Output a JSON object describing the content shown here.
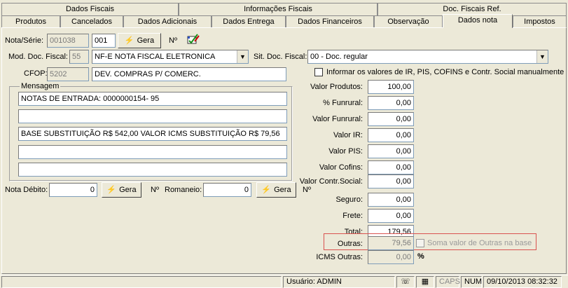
{
  "tabs_top": [
    "Dados Fiscais",
    "Informações Fiscais",
    "Doc. Fiscais Ref."
  ],
  "tabs_bottom": [
    "Produtos",
    "Cancelados",
    "Dados Adicionais",
    "Dados Entrega",
    "Dados Financeiros",
    "Observação",
    "Dados nota",
    "Impostos"
  ],
  "nota": {
    "nota_serie_label": "Nota/Série:",
    "numero": "001038",
    "serie": "001",
    "gera_label": "Gera",
    "n_label": "Nº"
  },
  "mod_doc": {
    "label": "Mod. Doc. Fiscal:",
    "code": "55",
    "desc": "NF-E NOTA FISCAL ELETRONICA"
  },
  "sit_doc": {
    "label": "Sit. Doc. Fiscal:",
    "value": "00 - Doc. regular"
  },
  "cfop": {
    "label": "CFOP:",
    "code": "5202",
    "desc": "DEV. COMPRAS P/ COMERC."
  },
  "manual_check_label": "Informar os valores de IR, PIS, COFINS e Contr. Social manualmente",
  "mensagem": {
    "title": "Mensagem",
    "lines": [
      "NOTAS DE ENTRADA: 0000000154- 95",
      "",
      "BASE SUBSTITUIÇÃO R$ 542,00 VALOR ICMS SUBSTITUIÇÃO R$ 79,56",
      "",
      ""
    ]
  },
  "nota_debito": {
    "label": "Nota Débito:",
    "value": "0",
    "gera_label": "Gera",
    "n_label": "Nº"
  },
  "romaneio": {
    "label": "Romaneio:",
    "value": "0",
    "gera_label": "Gera"
  },
  "valores": [
    {
      "label": "Valor Produtos:",
      "value": "100,00"
    },
    {
      "label": "% Funrural:",
      "value": "0,00"
    },
    {
      "label": "Valor Funrural:",
      "value": "0,00"
    },
    {
      "label": "Valor IR:",
      "value": "0,00"
    },
    {
      "label": "Valor PIS:",
      "value": "0,00"
    },
    {
      "label": "Valor Cofins:",
      "value": "0,00"
    },
    {
      "label": "Valor Contr.Social:",
      "value": "0,00"
    },
    {
      "label": "Seguro:",
      "value": "0,00"
    },
    {
      "label": "Frete:",
      "value": "0,00"
    },
    {
      "label": "Total:",
      "value": "179,56"
    }
  ],
  "outras": {
    "label": "Outras:",
    "value": "79,56",
    "check_label": "Soma valor de Outras na base"
  },
  "icms_outras": {
    "label": "ICMS Outras:",
    "value": "0,00",
    "suffix": "%"
  },
  "statusbar": {
    "user": "Usuário: ADMIN",
    "caps": "CAPS",
    "num": "NUM",
    "datetime": "09/10/2013 08:32:32"
  },
  "colors": {
    "highlight_border": "#d9534f",
    "window_bg": "#ece9d8"
  }
}
